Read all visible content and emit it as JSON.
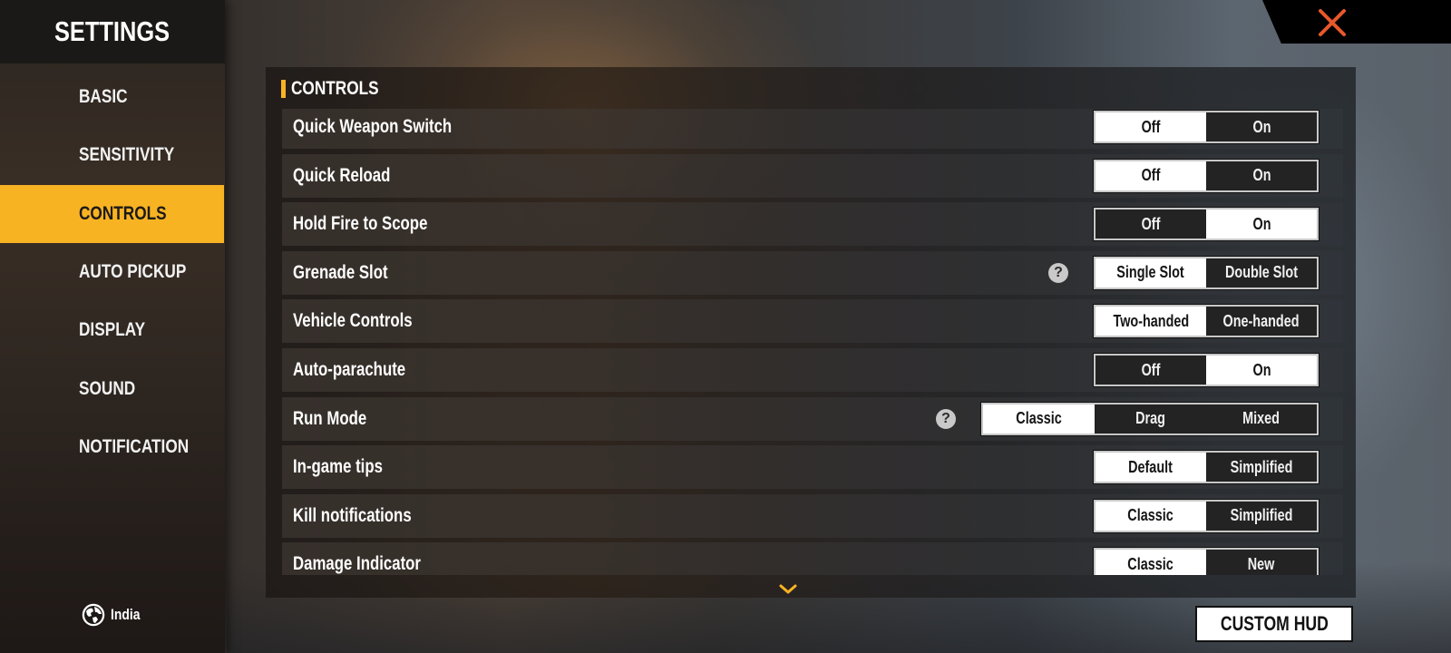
{
  "sidebar": {
    "title": "SETTINGS",
    "items": [
      {
        "label": "BASIC",
        "active": false
      },
      {
        "label": "SENSITIVITY",
        "active": false
      },
      {
        "label": "CONTROLS",
        "active": true
      },
      {
        "label": "AUTO PICKUP",
        "active": false
      },
      {
        "label": "DISPLAY",
        "active": false
      },
      {
        "label": "SOUND",
        "active": false
      },
      {
        "label": "NOTIFICATION",
        "active": false
      }
    ],
    "region": {
      "icon": "globe-icon",
      "label": "India"
    }
  },
  "close_button": {
    "icon": "close-icon",
    "color": "#e8582a"
  },
  "panel": {
    "title": "CONTROLS",
    "accent_color": "#f8b323",
    "settings": [
      {
        "label": "Quick Weapon Switch",
        "help": false,
        "options": [
          "Off",
          "On"
        ],
        "selected": 0
      },
      {
        "label": "Quick Reload",
        "help": false,
        "options": [
          "Off",
          "On"
        ],
        "selected": 0
      },
      {
        "label": "Hold Fire to Scope",
        "help": false,
        "options": [
          "Off",
          "On"
        ],
        "selected": 1
      },
      {
        "label": "Grenade Slot",
        "help": true,
        "options": [
          "Single Slot",
          "Double Slot"
        ],
        "selected": 0
      },
      {
        "label": "Vehicle Controls",
        "help": false,
        "options": [
          "Two-handed",
          "One-handed"
        ],
        "selected": 0
      },
      {
        "label": "Auto-parachute",
        "help": false,
        "options": [
          "Off",
          "On"
        ],
        "selected": 1
      },
      {
        "label": "Run Mode",
        "help": true,
        "options": [
          "Classic",
          "Drag",
          "Mixed"
        ],
        "selected": 0
      },
      {
        "label": "In-game tips",
        "help": false,
        "options": [
          "Default",
          "Simplified"
        ],
        "selected": 0
      },
      {
        "label": "Kill notifications",
        "help": false,
        "options": [
          "Classic",
          "Simplified"
        ],
        "selected": 0
      },
      {
        "label": "Damage Indicator",
        "help": false,
        "options": [
          "Classic",
          "New"
        ],
        "selected": 0
      }
    ],
    "help_glyph": "?",
    "scroll_icon": "chevron-down-icon"
  },
  "custom_hud_button": {
    "label": "CUSTOM HUD"
  }
}
